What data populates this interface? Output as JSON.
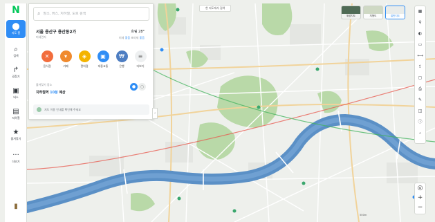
{
  "brand": {
    "logo": "N",
    "color": "#03c75a"
  },
  "nav": {
    "items": [
      {
        "label": "지도 홈",
        "icon": "map-pin-icon"
      },
      {
        "label": "검색",
        "icon": "search-icon"
      },
      {
        "label": "길찾기",
        "icon": "route-icon"
      },
      {
        "label": "버스",
        "icon": "bus-icon"
      },
      {
        "label": "지하철",
        "icon": "subway-icon"
      },
      {
        "label": "즐겨찾기",
        "icon": "star-icon"
      },
      {
        "label": "더보기",
        "icon": "more-icon"
      }
    ]
  },
  "search": {
    "placeholder": "장소, 버스, 지하철, 도로 검색"
  },
  "location": {
    "title": "서울 용산구 용산동2가",
    "sub": "미세먼지",
    "temp": "흐림 28°",
    "links_prefix": "미세",
    "links_mid": "좋음",
    "links_sep": "초미세",
    "links_end": "좋음"
  },
  "categories": [
    {
      "label": "음식점",
      "color": "#f26d3d",
      "glyph": "🍴"
    },
    {
      "label": "카페",
      "color": "#f08a2e",
      "glyph": "☕"
    },
    {
      "label": "편의점",
      "color": "#f4b400",
      "glyph": "🛒"
    },
    {
      "label": "대중교통",
      "color": "#2f8df5",
      "glyph": "🚌"
    },
    {
      "label": "은행",
      "color": "#4e7ec2",
      "glyph": "₩"
    },
    {
      "label": "더보기",
      "color": "#eef0f1",
      "glyph": "≡"
    }
  ],
  "recent": {
    "title": "즐겨찾기 장소",
    "text_prefix": "지하철역 ",
    "text_blue": "10분",
    "text_suffix": " 예상"
  },
  "notice": "지도 이용 안내를 확인해 주세요",
  "top_pill": "현 지도에서 검색",
  "layers": [
    {
      "label": "위성지도"
    },
    {
      "label": "지형도"
    },
    {
      "label": "일반지도",
      "selected": true
    }
  ],
  "tools": [
    {
      "icon": "traffic-icon",
      "label": "교통"
    },
    {
      "icon": "bike-icon",
      "label": "자전거"
    },
    {
      "icon": "street-icon",
      "label": "거리뷰"
    },
    {
      "icon": "cctv-icon",
      "label": "CCTV"
    },
    {
      "icon": "measure-icon",
      "label": "거리"
    },
    {
      "icon": "share-icon",
      "label": "공유"
    },
    {
      "icon": "save-icon",
      "label": "저장"
    },
    {
      "icon": "print-icon",
      "label": "인쇄"
    },
    {
      "icon": "pen-icon",
      "label": "그리기"
    },
    {
      "icon": "layer-icon",
      "label": "레이어"
    },
    {
      "icon": "info-icon",
      "label": "정보"
    },
    {
      "icon": "chevron-up-icon",
      "label": ""
    }
  ],
  "zoom": {
    "plus": "+",
    "minus": "−",
    "locate": "◎"
  },
  "scale": "500m",
  "colors": {
    "river": "#5b90c6",
    "park": "#b9d9a8",
    "road": "#ffffff",
    "road_major": "#f1d39a",
    "land": "#eef0ec"
  }
}
